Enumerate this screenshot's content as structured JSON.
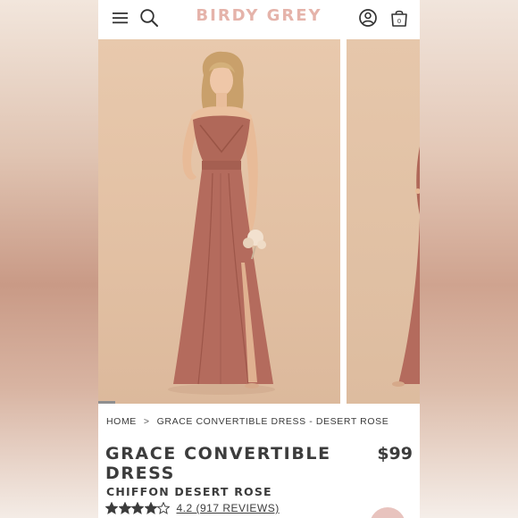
{
  "header": {
    "brand": "BIRDY GREY",
    "cart_count": "0",
    "brand_color": "#e5b3aa"
  },
  "icons": [
    "menu-icon",
    "search-icon",
    "account-icon",
    "cart-icon"
  ],
  "carousel": {
    "progress": 0.07,
    "main_image": "model-in-desert-rose-strapless-gown",
    "next_image": "partial-second-product-image"
  },
  "breadcrumb": {
    "home": "HOME",
    "separator": ">",
    "current": "GRACE CONVERTIBLE DRESS - DESERT ROSE"
  },
  "product": {
    "title": "GRACE CONVERTIBLE DRESS",
    "price": "$99",
    "subtitle": "CHIFFON DESERT ROSE",
    "rating_value": 4.2,
    "rating_text": "4.2 (917 REVIEWS)",
    "stars_filled": 4,
    "stars_total": 5
  },
  "colors": {
    "dress": "#b26a5c",
    "studio_bg": "#e4c4a7",
    "text": "#3c3c3c"
  }
}
